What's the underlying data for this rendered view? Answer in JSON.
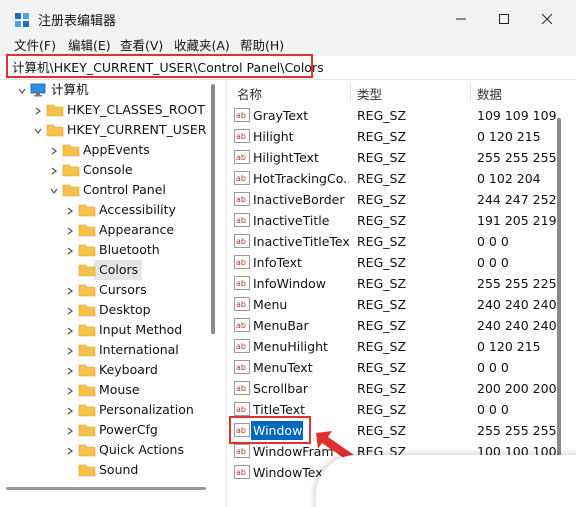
{
  "window": {
    "title": "注册表编辑器"
  },
  "menu": {
    "items": [
      "文件(F)",
      "编辑(E)",
      "查看(V)",
      "收藏夹(A)",
      "帮助(H)"
    ]
  },
  "address": {
    "path": "计算机\\HKEY_CURRENT_USER\\Control Panel\\Colors"
  },
  "tree": {
    "root": "计算机",
    "hkcr": "HKEY_CLASSES_ROOT",
    "hkcu": "HKEY_CURRENT_USER",
    "appevents": "AppEvents",
    "console": "Console",
    "control_panel": "Control Panel",
    "children": [
      "Accessibility",
      "Appearance",
      "Bluetooth",
      "Colors",
      "Cursors",
      "Desktop",
      "Input Method",
      "International",
      "Keyboard",
      "Mouse",
      "Personalization",
      "PowerCfg",
      "Quick Actions",
      "Sound"
    ],
    "selected": "Colors"
  },
  "list": {
    "headers": {
      "name": "名称",
      "type": "类型",
      "data": "数据"
    },
    "rows": [
      {
        "name": "GrayText",
        "type": "REG_SZ",
        "data": "109 109 109"
      },
      {
        "name": "Hilight",
        "type": "REG_SZ",
        "data": "0 120 215"
      },
      {
        "name": "HilightText",
        "type": "REG_SZ",
        "data": "255 255 255"
      },
      {
        "name": "HotTrackingCo...",
        "type": "REG_SZ",
        "data": "0 102 204"
      },
      {
        "name": "InactiveBorder",
        "type": "REG_SZ",
        "data": "244 247 252"
      },
      {
        "name": "InactiveTitle",
        "type": "REG_SZ",
        "data": "191 205 219"
      },
      {
        "name": "InactiveTitleText",
        "type": "REG_SZ",
        "data": "0 0 0"
      },
      {
        "name": "InfoText",
        "type": "REG_SZ",
        "data": "0 0 0"
      },
      {
        "name": "InfoWindow",
        "type": "REG_SZ",
        "data": "255 255 225"
      },
      {
        "name": "Menu",
        "type": "REG_SZ",
        "data": "240 240 240"
      },
      {
        "name": "MenuBar",
        "type": "REG_SZ",
        "data": "240 240 240"
      },
      {
        "name": "MenuHilight",
        "type": "REG_SZ",
        "data": "0 120 215"
      },
      {
        "name": "MenuText",
        "type": "REG_SZ",
        "data": "0 0 0"
      },
      {
        "name": "Scrollbar",
        "type": "REG_SZ",
        "data": "200 200 200"
      },
      {
        "name": "TitleText",
        "type": "REG_SZ",
        "data": "0 0 0"
      },
      {
        "name": "Window",
        "type": "REG_SZ",
        "data": "255 255 255"
      },
      {
        "name": "WindowFram",
        "type": "REG_SZ",
        "data": "100 100 100"
      },
      {
        "name": "WindowTex",
        "type": "",
        "data": ""
      }
    ],
    "selected": "Window"
  },
  "colors": {
    "accent": "#0067c0",
    "highlight_box": "#e0312e",
    "folder": "#f8c24a"
  },
  "icons": {
    "app": "registry-editor-icon",
    "value": "ab-string-value-icon",
    "folder": "folder-icon",
    "computer": "computer-icon"
  }
}
